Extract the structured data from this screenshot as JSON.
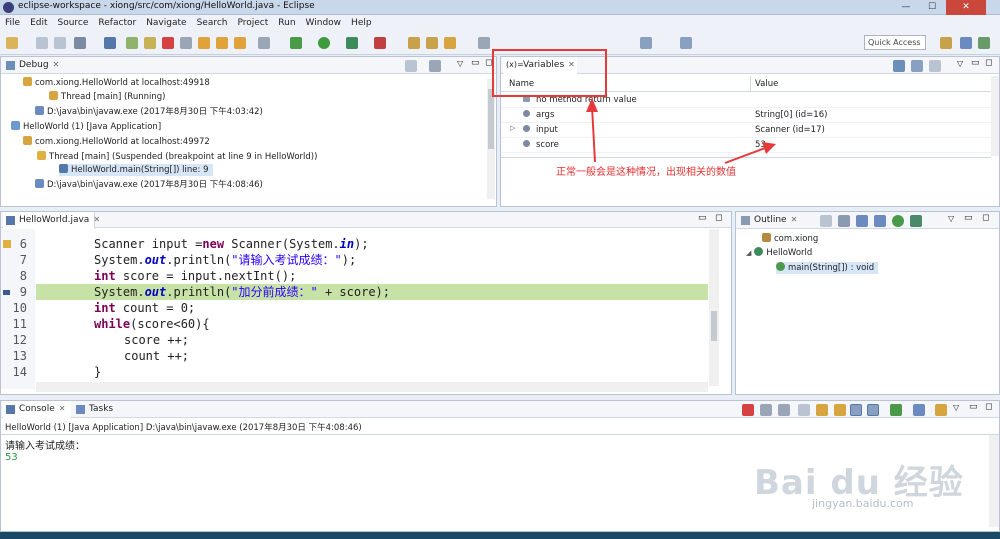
{
  "window": {
    "title": "eclipse-workspace - xiong/src/com/xiong/HelloWorld.java - Eclipse",
    "minimize": "—",
    "maximize": "☐",
    "close": "✕"
  },
  "menu": [
    "File",
    "Edit",
    "Source",
    "Refactor",
    "Navigate",
    "Search",
    "Project",
    "Run",
    "Window",
    "Help"
  ],
  "toolbar": {
    "quick_access_placeholder": "Quick Access"
  },
  "debug_view": {
    "tab_label": "Debug",
    "rows": [
      "com.xiong.HelloWorld at localhost:49918",
      "Thread [main] (Running)",
      "D:\\java\\bin\\javaw.exe (2017年8月30日 下午4:03:42)",
      "HelloWorld (1) [Java Application]",
      "com.xiong.HelloWorld at localhost:49972",
      "Thread [main] (Suspended (breakpoint at line 9 in HelloWorld))",
      "HelloWorld.main(String[]) line: 9",
      "D:\\java\\bin\\javaw.exe (2017年8月30日 下午4:08:46)"
    ]
  },
  "variables_view": {
    "tab_label": "Variables",
    "columns": [
      "Name",
      "Value"
    ],
    "rows": [
      {
        "name": "no method return value",
        "value": ""
      },
      {
        "name": "args",
        "value": "String[0]  (id=16)"
      },
      {
        "name": "input",
        "value": "Scanner  (id=17)"
      },
      {
        "name": "score",
        "value": "53"
      }
    ]
  },
  "annotation": {
    "text": "正常一般会是这种情况，出现相关的数值",
    "color": "#e23030"
  },
  "editor": {
    "tab_label": "HelloWorld.java",
    "current_line": 9,
    "lines": [
      {
        "num": "6",
        "code": "Scanner input =new Scanner(System.in);"
      },
      {
        "num": "7",
        "code": "System.out.println(\"请输入考试成绩：\");"
      },
      {
        "num": "8",
        "code": "int score = input.nextInt();"
      },
      {
        "num": "9",
        "code": "System.out.println(\"加分前成绩：\" + score);"
      },
      {
        "num": "10",
        "code": "int count = 0;"
      },
      {
        "num": "11",
        "code": "while(score<60){"
      },
      {
        "num": "12",
        "code": "score ++;"
      },
      {
        "num": "13",
        "code": "count ++;"
      },
      {
        "num": "14",
        "code": "}"
      }
    ]
  },
  "outline_view": {
    "tab_label": "Outline",
    "items": [
      "com.xiong",
      "HelloWorld",
      "main(String[]) : void"
    ]
  },
  "console_view": {
    "tabs": [
      "Console",
      "Tasks"
    ],
    "process": "HelloWorld (1) [Java Application] D:\\java\\bin\\javaw.exe (2017年8月30日 下午4:08:46)",
    "output": [
      "请输入考试成绩：",
      "53"
    ]
  },
  "watermark": {
    "logo": "Bai du 经验",
    "url": "jingyan.baidu.com"
  }
}
